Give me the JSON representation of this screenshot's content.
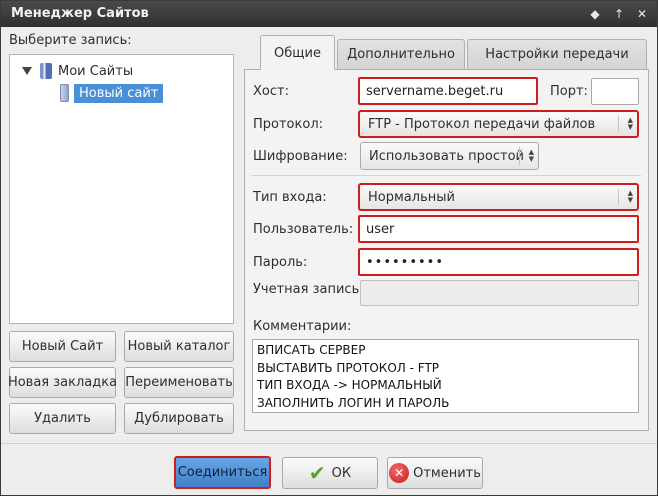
{
  "window": {
    "title": "Менеджер Сайтов",
    "controls": {
      "pin": "◆",
      "maximize": "↑",
      "close": "✕"
    }
  },
  "left": {
    "prompt": "Выберите запись:",
    "tree": {
      "root_label": "Мои Сайты",
      "child_label": "Новый сайт"
    },
    "buttons": {
      "new_site": "Новый Сайт",
      "new_folder": "Новый каталог",
      "new_bookmark": "Новая закладка",
      "rename": "Переименовать",
      "delete": "Удалить",
      "duplicate": "Дублировать"
    }
  },
  "tabs": [
    {
      "label": "Общие",
      "active": true
    },
    {
      "label": "Дополнительно",
      "active": false
    },
    {
      "label": "Настройки передачи",
      "active": false
    }
  ],
  "form": {
    "host_label": "Хост:",
    "host_value": "servername.beget.ru",
    "port_label": "Порт:",
    "port_value": "",
    "protocol_label": "Протокол:",
    "protocol_value": "FTP - Протокол передачи файлов",
    "encryption_label": "Шифрование:",
    "encryption_value": "Использовать простой",
    "logon_label": "Тип входа:",
    "logon_value": "Нормальный",
    "user_label": "Пользователь:",
    "user_value": "user",
    "password_label": "Пароль:",
    "password_value": "•••••••••",
    "account_label": "Учетная запись:",
    "account_value": "",
    "comments_label": "Комментарии:",
    "comments_lines": [
      "ВПИСАТЬ СЕРВЕР",
      "ВЫСТАВИТЬ ПРОТОКОЛ - FTP",
      "ТИП ВХОДА -> НОРМАЛЬНЫЙ",
      "ЗАПОЛНИТЬ ЛОГИН И ПАРОЛЬ"
    ]
  },
  "footer": {
    "connect": "Соединиться",
    "ok": "ОК",
    "cancel": "Отменить"
  },
  "colors": {
    "highlight": "#d01c1c",
    "selection": "#4a90d9",
    "connect_button": "#4f8fd6"
  }
}
